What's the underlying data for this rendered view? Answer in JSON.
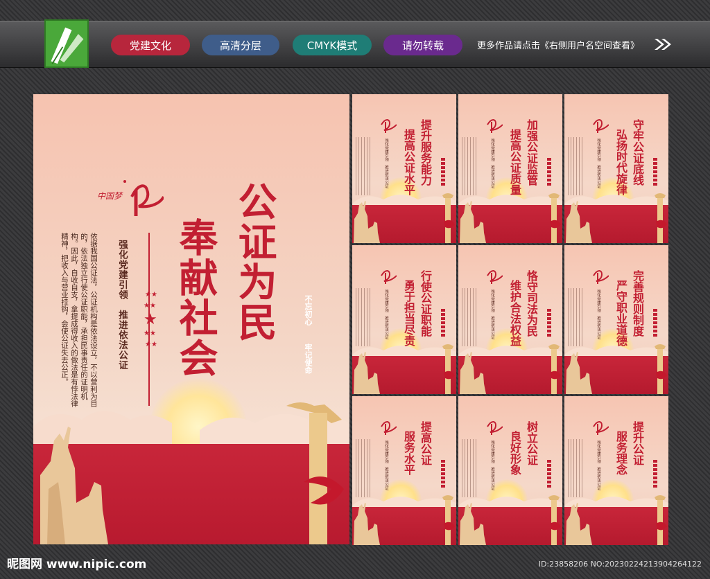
{
  "header": {
    "tags": [
      "党建文化",
      "高清分层",
      "CMYK模式",
      "请勿转载"
    ],
    "more_text": "更多作品请点击《右侧用户名空间查看》",
    "logo_icon": "pen-nib-icon",
    "arrow_icon": "double-chevron-right-icon"
  },
  "main_poster": {
    "brand_text": "中国梦",
    "title_1": "公证为民",
    "title_2": "奉献社会",
    "subtitle": "强化党建引领　推进依法公证",
    "body": "依据我国公证法，公证机构是依法设立，不以营利为目的，依法独立行使公证职能，承担民事责任的证明机构。因此，自收自支，拿提成得收入的做法是有悖法律精神，把收入与营业挂钩，会使公证失去公正。",
    "slogan_1": "不忘初心",
    "slogan_2": "牢记使命",
    "colors": {
      "accent": "#c21f32",
      "bg": "#f6c3b0"
    }
  },
  "small_posters": [
    {
      "t1": "提升服务能力",
      "t2": "提高公证水平"
    },
    {
      "t1": "加强公证监管",
      "t2": "提高公证质量"
    },
    {
      "t1": "守牢公证底线",
      "t2": "弘扬时代旋律"
    },
    {
      "t1": "行使公证职能",
      "t2": "勇于担当尽责"
    },
    {
      "t1": "恪守司法为民",
      "t2": "维护合法权益"
    },
    {
      "t1": "完善规则制度",
      "t2": "严守职业道德"
    },
    {
      "t1": "提高公证",
      "t2": "服务水平"
    },
    {
      "t1": "树立公证",
      "t2": "良好形象"
    },
    {
      "t1": "提升公证",
      "t2": "服务理念"
    }
  ],
  "small_poster_sub": "强化党建引领　推进依法公证",
  "footer": {
    "site": "昵图网 www.nipic.com",
    "id_text": "ID:23858206 NO:20230224213904264122"
  }
}
